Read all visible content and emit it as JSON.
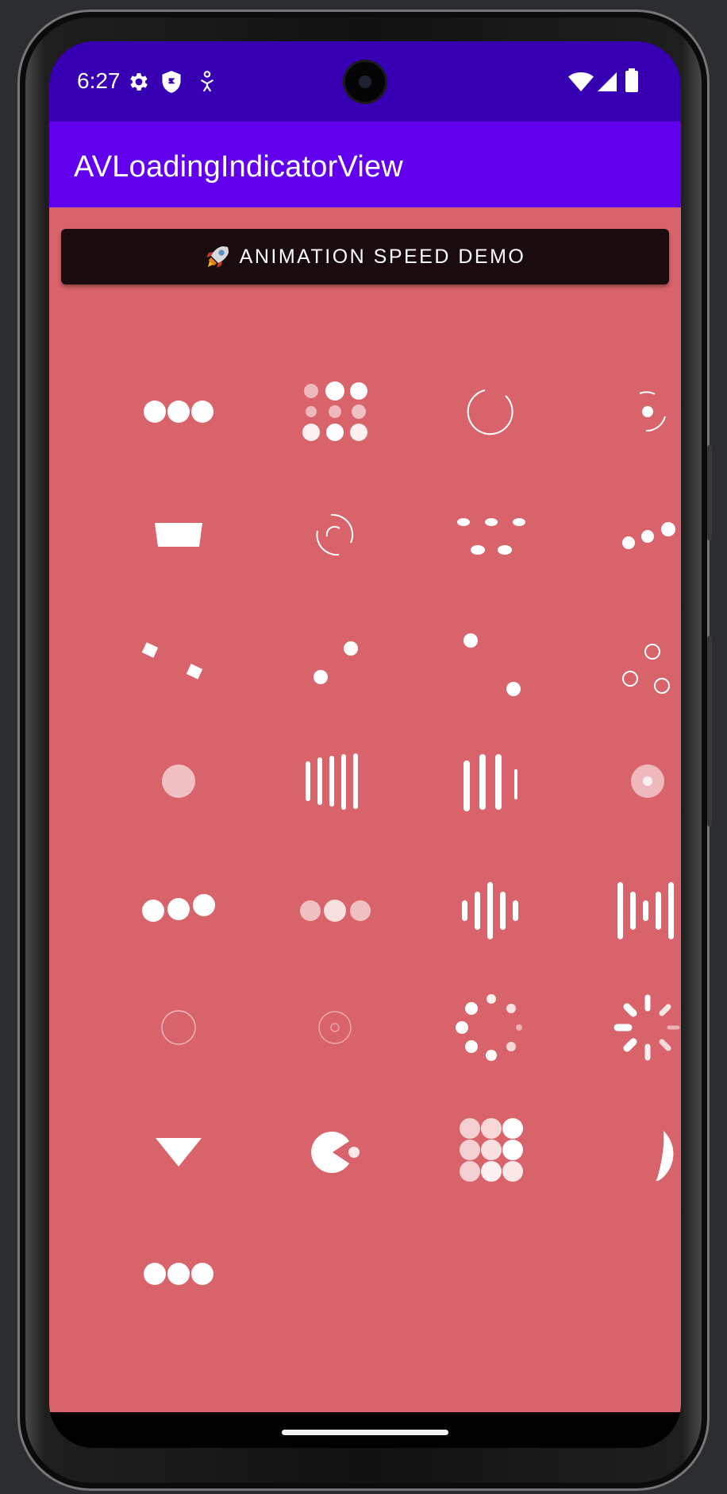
{
  "status_bar": {
    "time": "6:27",
    "icons": [
      "gear-icon",
      "shield-icon",
      "accessibility-icon",
      "wifi-icon",
      "signal-icon",
      "battery-icon"
    ]
  },
  "app_bar": {
    "title": "AVLoadingIndicatorView"
  },
  "demo_button": {
    "label": "ANIMATION SPEED DEMO",
    "icon": "rocket-icon"
  },
  "indicators": [
    {
      "name": "ball-pulse-indicator"
    },
    {
      "name": "ball-grid-pulse-indicator"
    },
    {
      "name": "ball-clip-rotate-indicator"
    },
    {
      "name": "ball-clip-rotate-pulse-indicator"
    },
    {
      "name": "square-spin-indicator"
    },
    {
      "name": "ball-clip-rotate-multiple-indicator"
    },
    {
      "name": "ball-pulse-rise-indicator"
    },
    {
      "name": "ball-rotate-indicator"
    },
    {
      "name": "cube-transition-indicator"
    },
    {
      "name": "ball-zig-zag-indicator"
    },
    {
      "name": "ball-zig-zag-deflect-indicator"
    },
    {
      "name": "ball-triangle-path-indicator"
    },
    {
      "name": "ball-scale-indicator"
    },
    {
      "name": "line-scale-indicator"
    },
    {
      "name": "line-scale-party-indicator"
    },
    {
      "name": "ball-scale-multiple-indicator"
    },
    {
      "name": "ball-pulse-sync-indicator"
    },
    {
      "name": "ball-beat-indicator"
    },
    {
      "name": "line-scale-pulse-out-indicator"
    },
    {
      "name": "line-scale-pulse-out-rapid-indicator"
    },
    {
      "name": "ball-scale-ripple-indicator"
    },
    {
      "name": "ball-scale-ripple-multiple-indicator"
    },
    {
      "name": "ball-spin-fade-loader-indicator"
    },
    {
      "name": "line-spin-fade-loader-indicator"
    },
    {
      "name": "triangle-skew-spin-indicator"
    },
    {
      "name": "pacman-indicator"
    },
    {
      "name": "ball-grid-beat-indicator"
    },
    {
      "name": "semi-circle-spin-indicator"
    },
    {
      "name": "ball-pulse-indicator-2"
    }
  ],
  "colors": {
    "status_bar": "#3700b3",
    "app_bar": "#6200ee",
    "content_background": "#d9636a",
    "button_background": "#1a0c0e",
    "indicator": "#ffffff"
  }
}
